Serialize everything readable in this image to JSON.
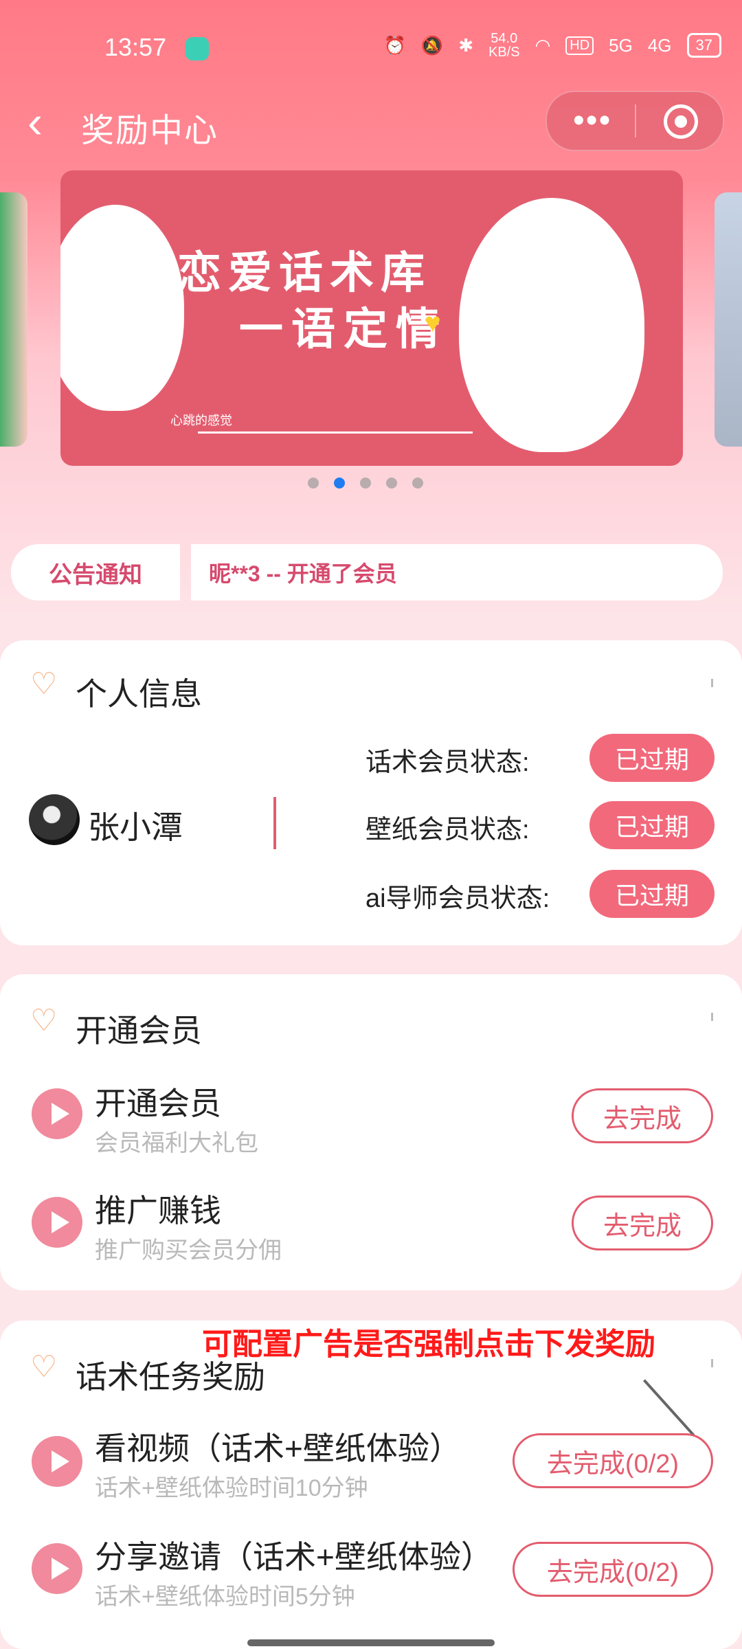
{
  "status_bar": {
    "time": "13:57",
    "net_speed": "54.0",
    "net_unit": "KB/S",
    "hd": "HD",
    "sig1": "5G",
    "sig2": "4G",
    "battery": "37"
  },
  "header": {
    "title": "奖励中心",
    "more_glyph": "•••"
  },
  "banner": {
    "line1": "恋爱话术库",
    "line2": "一语定情",
    "caption": "心跳的感觉",
    "page_count": 5,
    "active_index": 1
  },
  "notice": {
    "label": "公告通知",
    "text": "昵**3 -- 开通了会员"
  },
  "personal": {
    "section_title": "个人信息",
    "username": "张小潭",
    "rows": [
      {
        "label": "话术会员状态:",
        "status": "已过期"
      },
      {
        "label": "壁纸会员状态:",
        "status": "已过期"
      },
      {
        "label": "ai导师会员状态:",
        "status": "已过期"
      }
    ]
  },
  "membership": {
    "section_title": "开通会员",
    "tasks": [
      {
        "title": "开通会员",
        "subtitle": "会员福利大礼包",
        "button": "去完成"
      },
      {
        "title": "推广赚钱",
        "subtitle": "推广购买会员分佣",
        "button": "去完成"
      }
    ]
  },
  "rewards": {
    "section_title": "话术任务奖励",
    "note": "可配置广告是否强制点击下发奖励",
    "tasks": [
      {
        "title": "看视频（话术+壁纸体验）",
        "subtitle": "话术+壁纸体验时间10分钟",
        "button": "去完成(0/2)"
      },
      {
        "title": "分享邀请（话术+壁纸体验）",
        "subtitle": "话术+壁纸体验时间5分钟",
        "button": "去完成(0/2)"
      }
    ]
  },
  "colors": {
    "accent": "#e35c6e",
    "badge": "#f2697b",
    "notice_text": "#d64a6d",
    "note_red": "#ff1a1a"
  },
  "icons": {
    "back": "chevron-left-icon",
    "more": "more-dots-icon",
    "target": "target-icon",
    "section": "heart-pulse-icon",
    "play": "play-icon"
  }
}
